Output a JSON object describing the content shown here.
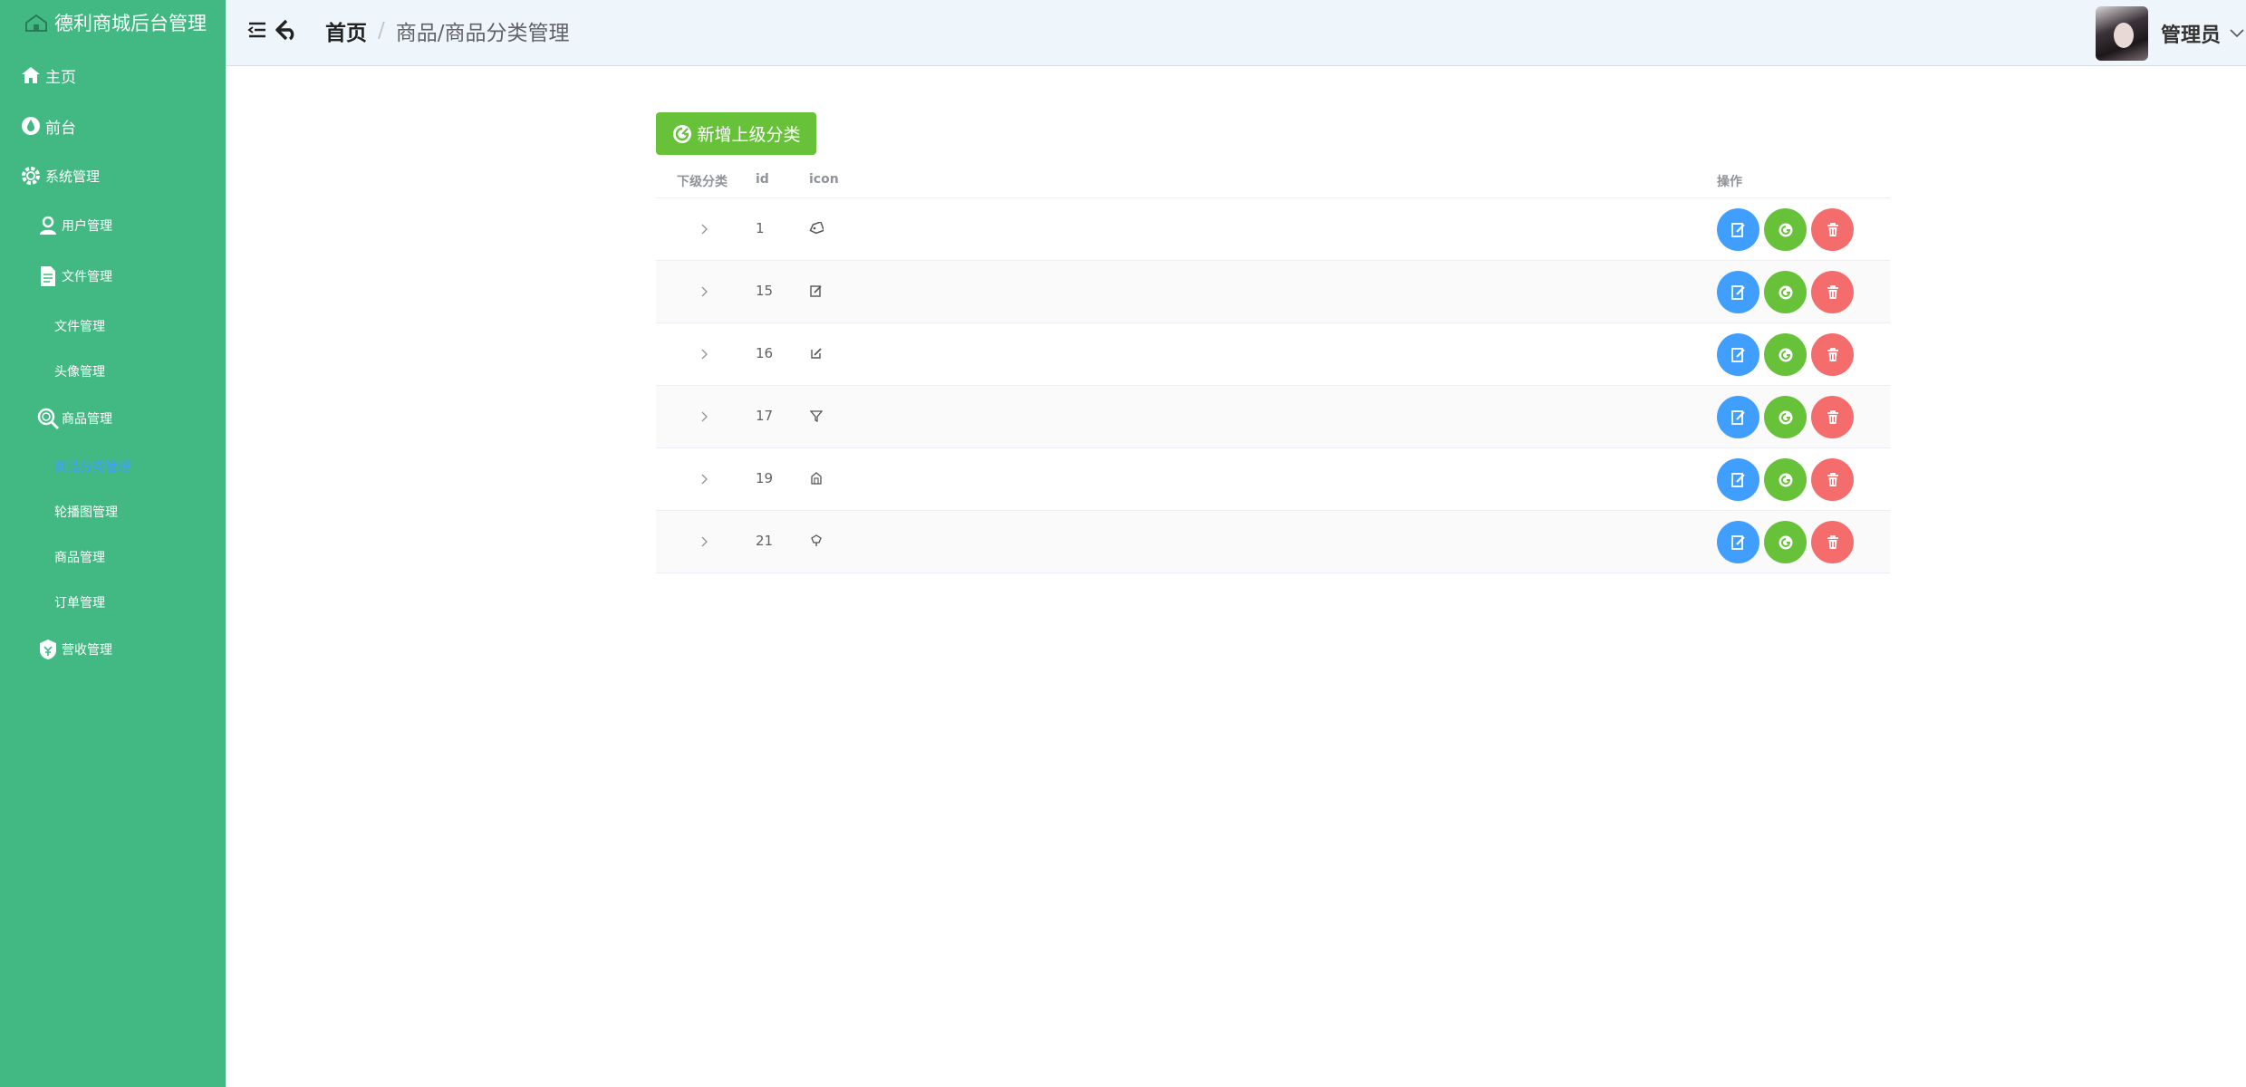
{
  "app": {
    "title": "德利商城后台管理"
  },
  "sidebar": {
    "items": [
      {
        "label": "主页",
        "icon": "home-icon"
      },
      {
        "label": "前台",
        "icon": "drop-icon"
      },
      {
        "label": "系统管理",
        "icon": "gear-icon"
      },
      {
        "label": "用户管理",
        "icon": "user-icon"
      },
      {
        "label": "文件管理",
        "icon": "document-icon"
      },
      {
        "label": "文件管理"
      },
      {
        "label": "头像管理"
      },
      {
        "label": "商品管理",
        "icon": "search-icon"
      },
      {
        "label": "商品分类管理",
        "active": true
      },
      {
        "label": "轮播图管理"
      },
      {
        "label": "商品管理"
      },
      {
        "label": "订单管理"
      },
      {
        "label": "营收管理",
        "icon": "money-icon"
      }
    ]
  },
  "header": {
    "breadcrumb_home": "首页",
    "breadcrumb_sep": "/",
    "breadcrumb_current": "商品/商品分类管理",
    "username": "管理员"
  },
  "main": {
    "add_button": "新增上级分类",
    "columns": {
      "expand": "下级分类",
      "id": "id",
      "icon": "icon",
      "ops": "操作"
    },
    "rows": [
      {
        "id": "1",
        "icon": "tag-icon"
      },
      {
        "id": "15",
        "icon": "edit-box-icon"
      },
      {
        "id": "16",
        "icon": "edit-icon"
      },
      {
        "id": "17",
        "icon": "filter-icon"
      },
      {
        "id": "19",
        "icon": "building-icon"
      },
      {
        "id": "21",
        "icon": "pin-icon"
      }
    ]
  },
  "colors": {
    "sidebar": "#42b983",
    "active": "#409eff",
    "primary": "#409eff",
    "success": "#67c23a",
    "danger": "#f56c6c"
  }
}
